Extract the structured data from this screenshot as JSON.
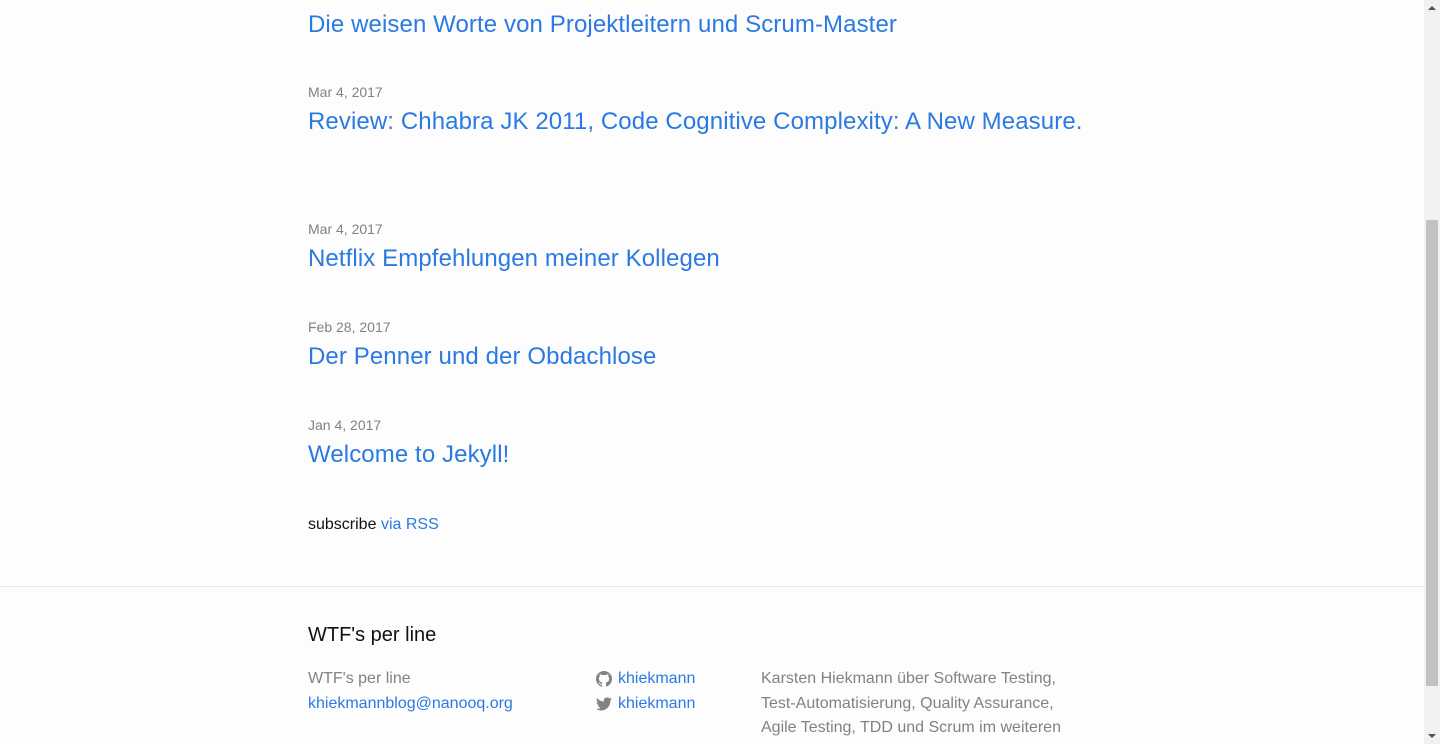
{
  "posts": [
    {
      "date": "",
      "title": "Die weisen Worte von Projektleitern und Scrum-Master"
    },
    {
      "date": "Mar 4, 2017",
      "title": "Review: Chhabra JK 2011, Code Cognitive Complexity: A New Measure."
    },
    {
      "date": "Mar 4, 2017",
      "title": "Netflix Empfehlungen meiner Kollegen"
    },
    {
      "date": "Feb 28, 2017",
      "title": "Der Penner und der Obdachlose"
    },
    {
      "date": "Jan 4, 2017",
      "title": "Welcome to Jekyll!"
    }
  ],
  "rss": {
    "prefix": "subscribe",
    "link_label": "via RSS"
  },
  "footer": {
    "heading": "WTF's per line",
    "site_name": "WTF's per line",
    "email": "khiekmannblog@nanooq.org",
    "github": {
      "icon": "github-icon",
      "label": "khiekmann"
    },
    "twitter": {
      "icon": "twitter-icon",
      "label": "khiekmann"
    },
    "description": "Karsten Hiekmann über Software Testing, Test-Automatisierung, Quality Assurance, Agile Testing, TDD und Scrum im weiteren Sinne."
  },
  "colors": {
    "link": "#2a7ae2",
    "meta": "#828282",
    "text": "#111111",
    "background": "#fdfdfd"
  }
}
